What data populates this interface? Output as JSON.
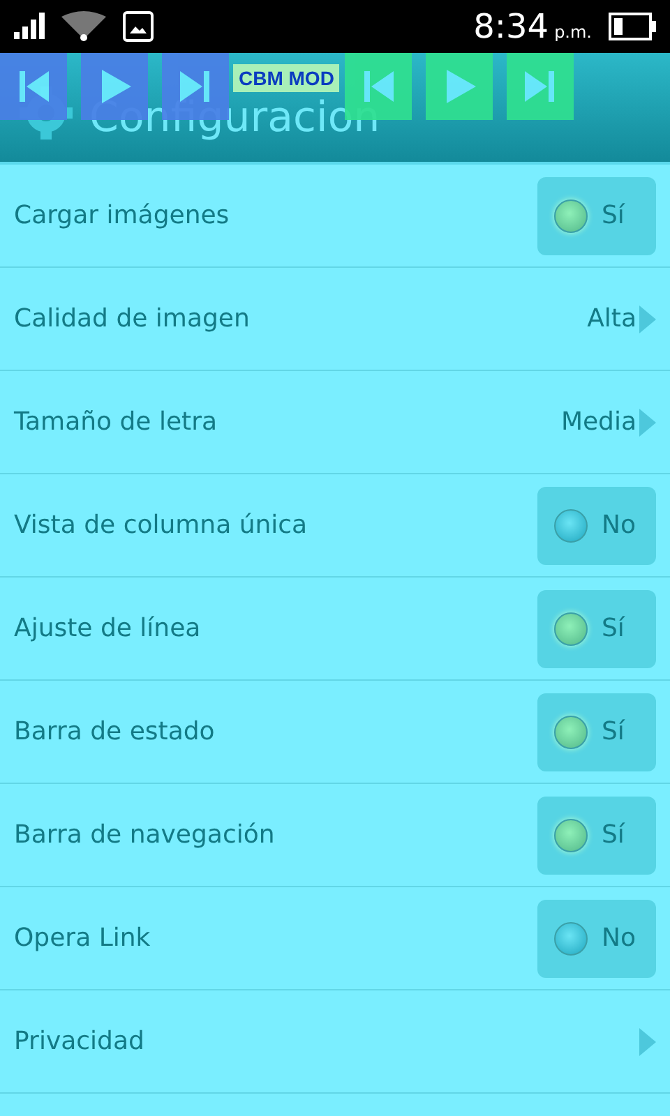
{
  "status_bar": {
    "time": "8:34",
    "period": "p.m."
  },
  "overlay": {
    "label": "CBM MOD",
    "groups": [
      {
        "color": "#4a7fe6"
      },
      {
        "color": "#30e090"
      }
    ]
  },
  "header": {
    "title": "Configuracion"
  },
  "settings": [
    {
      "kind": "toggle",
      "label": "Cargar imágenes",
      "value": "Sí",
      "on": true
    },
    {
      "kind": "choice",
      "label": "Calidad de imagen",
      "value": "Alta"
    },
    {
      "kind": "choice",
      "label": "Tamaño de letra",
      "value": "Media"
    },
    {
      "kind": "toggle",
      "label": "Vista de columna única",
      "value": "No",
      "on": false
    },
    {
      "kind": "toggle",
      "label": "Ajuste de línea",
      "value": "Sí",
      "on": true
    },
    {
      "kind": "toggle",
      "label": "Barra de estado",
      "value": "Sí",
      "on": true
    },
    {
      "kind": "toggle",
      "label": "Barra de navegación",
      "value": "Sí",
      "on": true
    },
    {
      "kind": "toggle",
      "label": "Opera Link",
      "value": "No",
      "on": false
    },
    {
      "kind": "link",
      "label": "Privacidad"
    }
  ]
}
